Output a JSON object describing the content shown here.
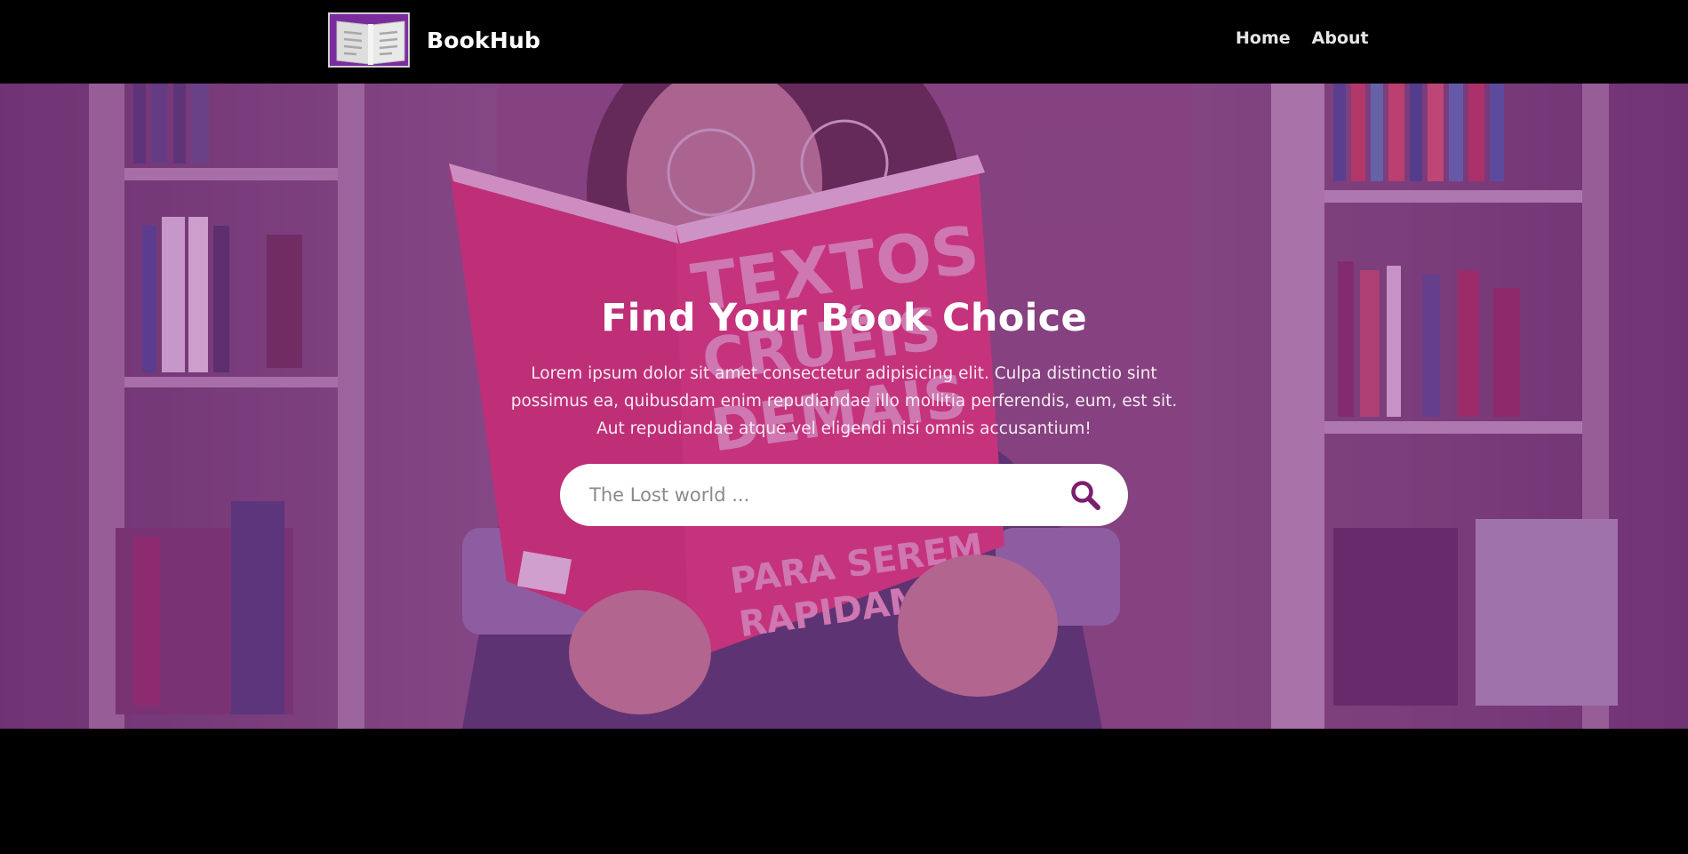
{
  "navbar": {
    "brand": "BookHub",
    "links": [
      {
        "label": "Home"
      },
      {
        "label": "About"
      }
    ]
  },
  "hero": {
    "title": "Find Your Book Choice",
    "description": "Lorem ipsum dolor sit amet consectetur adipisicing elit. Culpa distinctio sint possimus ea, quibusdam enim repudiandae illo mollitia perferendis, eum, est sit. Aut repudiandae atque vel eligendi nisi omnis accusantium!",
    "search": {
      "placeholder": "The Lost world ...",
      "value": "",
      "icon": "search-icon"
    }
  },
  "colors": {
    "accent": "#7b1f6e",
    "logo_bg": "#7b2c9c",
    "overlay": "#942896"
  }
}
